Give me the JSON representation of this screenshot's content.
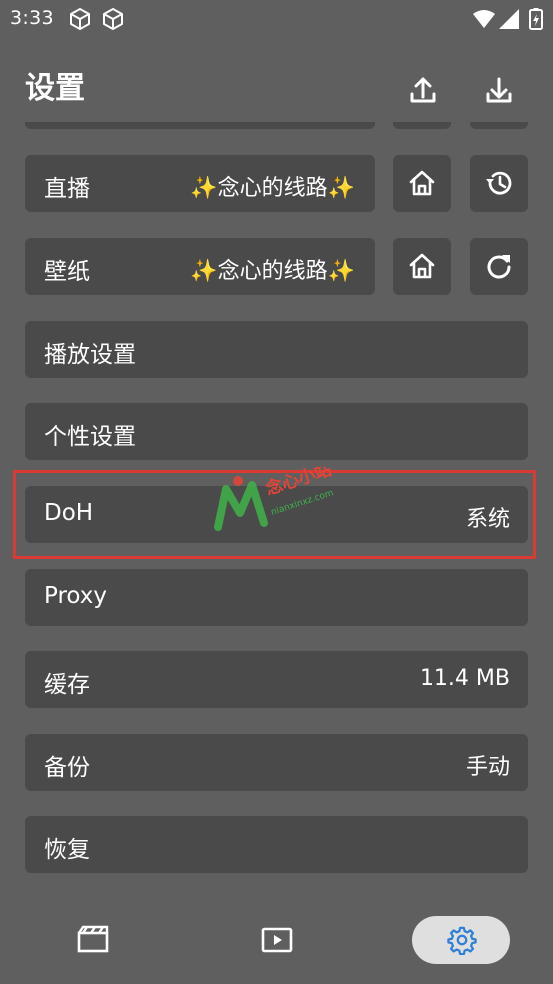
{
  "status_bar": {
    "time": "3:33"
  },
  "header": {
    "title": "设置"
  },
  "rows": {
    "live": {
      "label": "直播",
      "value": "✨念心的线路✨"
    },
    "wallpaper": {
      "label": "壁纸",
      "value": "✨念心的线路✨"
    },
    "playback": {
      "label": "播放设置"
    },
    "personal": {
      "label": "个性设置"
    },
    "doh": {
      "label": "DoH",
      "value": "系统"
    },
    "proxy": {
      "label": "Proxy"
    },
    "cache": {
      "label": "缓存",
      "value": "11.4 MB"
    },
    "backup": {
      "label": "备份",
      "value": "手动"
    },
    "restore": {
      "label": "恢复"
    }
  },
  "watermark": {
    "text": "念心小站",
    "url_text": "nianxinxz.com"
  },
  "colors": {
    "background": "#5f5f5f",
    "card": "#4a4a4a",
    "highlight": "#d93a33",
    "nav_active_bg": "#dfdfdf",
    "nav_active_icon": "#2f7fd6",
    "watermark_green": "#3fb24a",
    "watermark_red": "#e0463a"
  },
  "icons": {
    "upload": "upload-icon",
    "download": "download-icon",
    "home": "home-icon",
    "history": "history-icon",
    "refresh": "refresh-icon",
    "film": "film-icon",
    "play": "play-icon",
    "settings": "gear-icon"
  }
}
